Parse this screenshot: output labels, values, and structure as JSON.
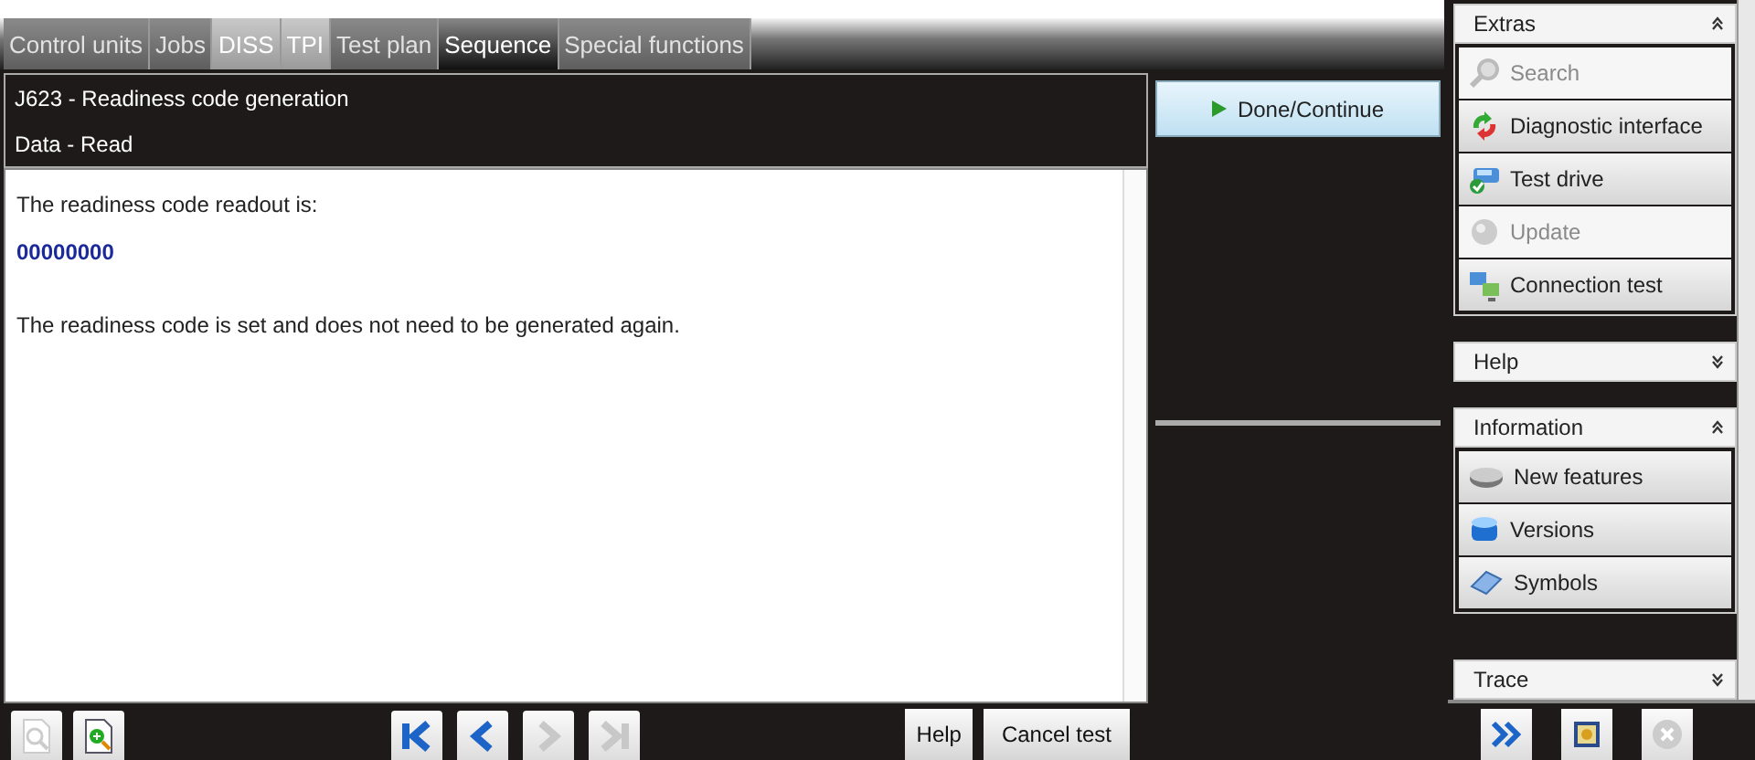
{
  "tabs": [
    {
      "label": "Control units",
      "selected": false,
      "disabled": true
    },
    {
      "label": "Jobs",
      "selected": false,
      "disabled": true
    },
    {
      "label": "DISS",
      "selected": false,
      "disabled": false
    },
    {
      "label": "TPI",
      "selected": false,
      "disabled": false
    },
    {
      "label": "Test plan",
      "selected": false,
      "disabled": true
    },
    {
      "label": "Sequence",
      "selected": true,
      "disabled": false
    },
    {
      "label": "Special functions",
      "selected": false,
      "disabled": true
    }
  ],
  "step": {
    "title": "J623 - Readiness code generation",
    "subtitle": "Data - Read",
    "lines": [
      {
        "kind": "text",
        "text": "The readiness code readout is:"
      },
      {
        "kind": "value",
        "text": "00000000"
      },
      {
        "kind": "text",
        "text": "The readiness code is set and does not need to be generated again."
      }
    ]
  },
  "action_button": {
    "label": "Done/Continue"
  },
  "toolbar": {
    "left": [
      {
        "disabled": true
      },
      {
        "disabled": false
      }
    ],
    "nav": [
      {
        "disabled": false
      },
      {
        "disabled": false
      },
      {
        "disabled": true
      },
      {
        "disabled": true
      }
    ],
    "buttons": [
      {
        "label": "Help",
        "disabled": false
      },
      {
        "label": "Cancel test",
        "disabled": false
      }
    ]
  },
  "sidebar": {
    "groups": [
      {
        "title": "Extras",
        "expanded": true,
        "items": [
          {
            "label": "Search",
            "disabled": true
          },
          {
            "label": "Diagnostic interface",
            "disabled": false
          },
          {
            "label": "Test drive",
            "disabled": false
          },
          {
            "label": "Update",
            "disabled": true
          },
          {
            "label": "Connection test",
            "disabled": false
          }
        ]
      },
      {
        "title": "Help",
        "expanded": false
      },
      {
        "title": "Information",
        "expanded": true,
        "items": [
          {
            "label": "New features",
            "disabled": false
          },
          {
            "label": "Versions",
            "disabled": false
          },
          {
            "label": "Symbols",
            "disabled": false
          }
        ]
      },
      {
        "title": "Trace",
        "expanded": false
      }
    ],
    "bottom": [
      {
        "disabled": false
      },
      {
        "disabled": false
      },
      {
        "disabled": true
      }
    ]
  }
}
